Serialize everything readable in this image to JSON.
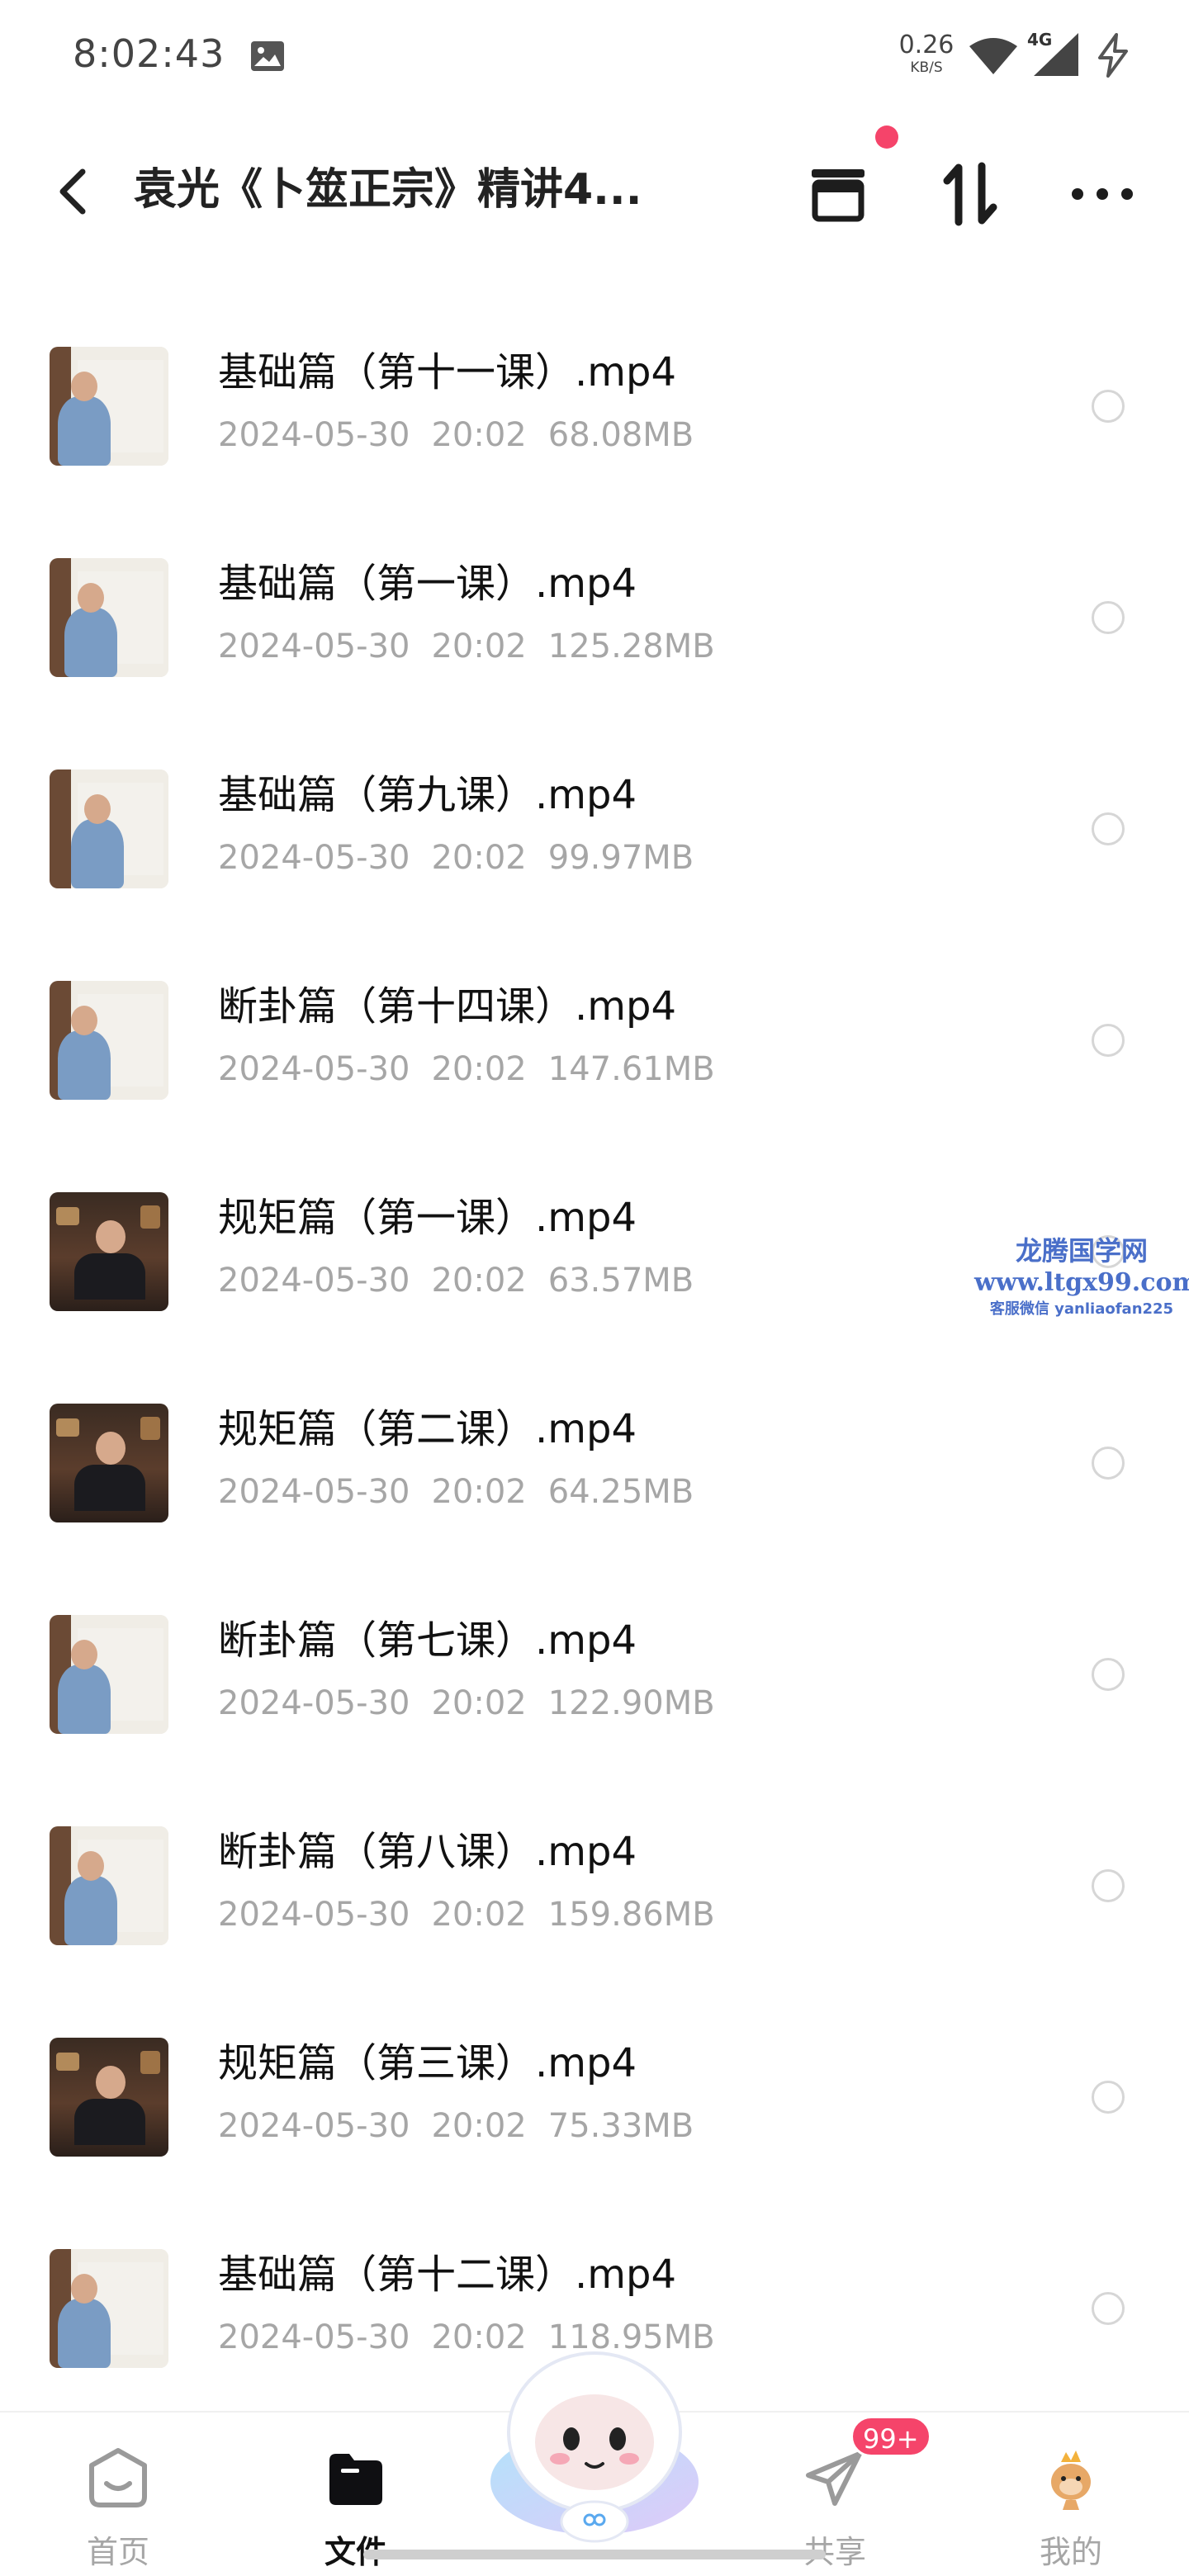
{
  "status_bar": {
    "time": "8:02:43",
    "net_speed_value": "0.26",
    "net_speed_unit": "KB/S",
    "signal_label": "4G"
  },
  "header": {
    "title": "袁光《卜筮正宗》精讲4..."
  },
  "files": [
    {
      "name": "基础篇（第十一课）.mp4",
      "date": "2024-05-30",
      "time": "20:02",
      "size": "68.08MB",
      "thumb": "board-teacher"
    },
    {
      "name": "基础篇（第一课）.mp4",
      "date": "2024-05-30",
      "time": "20:02",
      "size": "125.28MB",
      "thumb": "board-teacher"
    },
    {
      "name": "基础篇（第九课）.mp4",
      "date": "2024-05-30",
      "time": "20:02",
      "size": "99.97MB",
      "thumb": "board-teacher"
    },
    {
      "name": "断卦篇（第十四课）.mp4",
      "date": "2024-05-30",
      "time": "20:02",
      "size": "147.61MB",
      "thumb": "board-teacher"
    },
    {
      "name": "规矩篇（第一课）.mp4",
      "date": "2024-05-30",
      "time": "20:02",
      "size": "63.57MB",
      "thumb": "room-speaker"
    },
    {
      "name": "规矩篇（第二课）.mp4",
      "date": "2024-05-30",
      "time": "20:02",
      "size": "64.25MB",
      "thumb": "room-speaker"
    },
    {
      "name": "断卦篇（第七课）.mp4",
      "date": "2024-05-30",
      "time": "20:02",
      "size": "122.90MB",
      "thumb": "board-teacher"
    },
    {
      "name": "断卦篇（第八课）.mp4",
      "date": "2024-05-30",
      "time": "20:02",
      "size": "159.86MB",
      "thumb": "board-teacher"
    },
    {
      "name": "规矩篇（第三课）.mp4",
      "date": "2024-05-30",
      "time": "20:02",
      "size": "75.33MB",
      "thumb": "room-speaker"
    },
    {
      "name": "基础篇（第十二课）.mp4",
      "date": "2024-05-30",
      "time": "20:02",
      "size": "118.95MB",
      "thumb": "board-teacher"
    }
  ],
  "watermark": {
    "title": "龙腾国学网",
    "url": "www.ltgx99.com",
    "contact": "客服微信 yanliaofan225"
  },
  "bottom_nav": {
    "home": "首页",
    "files": "文件",
    "share": "共享",
    "mine": "我的",
    "share_badge": "99+"
  },
  "colors": {
    "accent_red": "#f5446a",
    "meta_gray": "#a6a6a6",
    "watermark_blue": "#4a6fc9"
  }
}
